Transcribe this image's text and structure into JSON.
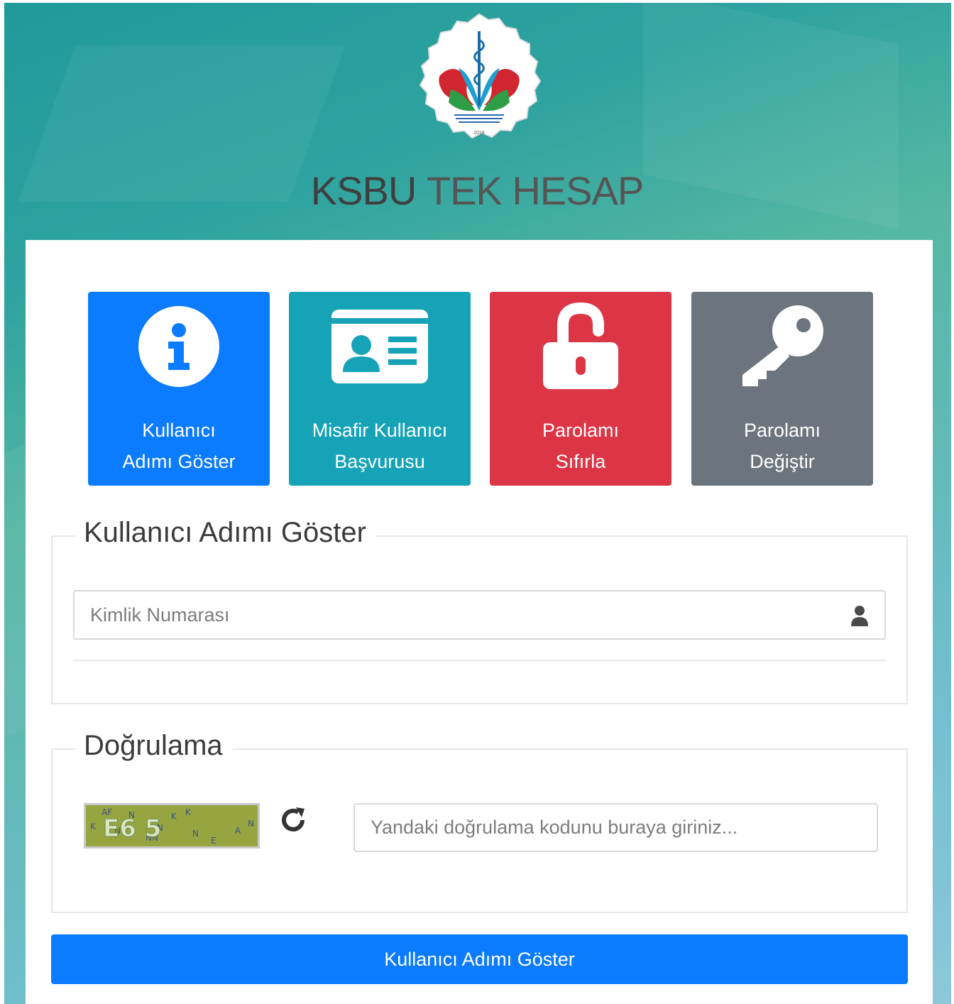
{
  "header": {
    "brand_bold": "KSBU",
    "brand_light": "TEK HESAP",
    "logo_year": "2018"
  },
  "tiles": [
    {
      "line1": "Kullanıcı",
      "line2": "Adımı Göster",
      "icon": "info-circle-icon",
      "color": "#0b7bff"
    },
    {
      "line1": "Misafir Kullanıcı",
      "line2": "Başvurusu",
      "icon": "id-card-icon",
      "color": "#16a3b7"
    },
    {
      "line1": "Parolamı",
      "line2": "Sıfırla",
      "icon": "unlock-icon",
      "color": "#dc3545"
    },
    {
      "line1": "Parolamı",
      "line2": "Değiştir",
      "icon": "key-icon",
      "color": "#6c757d"
    }
  ],
  "username_section": {
    "legend": "Kullanıcı Adımı Göster",
    "id_placeholder": "Kimlik Numarası",
    "icon": "user-icon"
  },
  "verification_section": {
    "legend": "Doğrulama",
    "captcha_text": "E6 5",
    "refresh_icon": "refresh-icon",
    "code_placeholder": "Yandaki doğrulama kodunu buraya giriniz..."
  },
  "submit_label": "Kullanıcı Adımı Göster"
}
